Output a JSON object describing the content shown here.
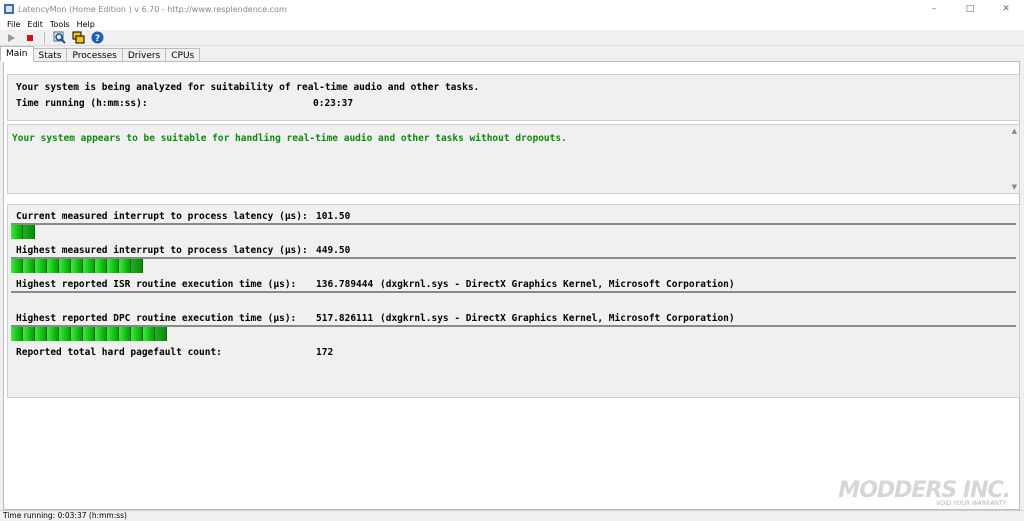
{
  "window": {
    "title": "LatencyMon  (Home Edition )  v 6.70 - http://www.resplendence.com",
    "icon": "latencymon-app-icon",
    "controls": [
      "minimize",
      "maximize",
      "close"
    ]
  },
  "menu": [
    "File",
    "Edit",
    "Tools",
    "Help"
  ],
  "toolbar": {
    "buttons": [
      "play-icon",
      "stop-icon",
      "search-icon",
      "windows-icon",
      "help-icon"
    ]
  },
  "tabs": [
    "Main",
    "Stats",
    "Processes",
    "Drivers",
    "CPUs"
  ],
  "active_tab": "Main",
  "analysis": {
    "line1": "Your system is being analyzed for suitability of real-time audio and other tasks.",
    "time_label": "Time running (h:mm:ss):",
    "time_value": "0:23:37"
  },
  "verdict": {
    "text": "Your system appears to be suitable for handling real-time audio and other tasks without dropouts.",
    "color": "#0c8a0c"
  },
  "metrics": [
    {
      "label": "Current measured interrupt to process latency (µs):",
      "value": "101.50",
      "detail": "",
      "bar_segments": 2
    },
    {
      "label": "Highest measured interrupt to process latency (µs):",
      "value": "449.50",
      "detail": "",
      "bar_segments": 11
    },
    {
      "label": "Highest reported ISR routine execution time (µs):",
      "value": "136.789444",
      "detail": "(dxgkrnl.sys - DirectX Graphics Kernel, Microsoft Corporation)",
      "bar_segments": 0
    },
    {
      "label": "Highest reported DPC routine execution time (µs):",
      "value": "517.826111",
      "detail": "(dxgkrnl.sys - DirectX Graphics Kernel, Microsoft Corporation)",
      "bar_segments": 13
    },
    {
      "label": "Reported total hard pagefault count:",
      "value": "172",
      "detail": ""
    }
  ],
  "bar_color": "#11c411",
  "status": "Time running: 0:03:37  (h:mm:ss)",
  "watermark": {
    "main": "MODDERS INC.",
    "sub": "VOID YOUR WARRANTY"
  }
}
